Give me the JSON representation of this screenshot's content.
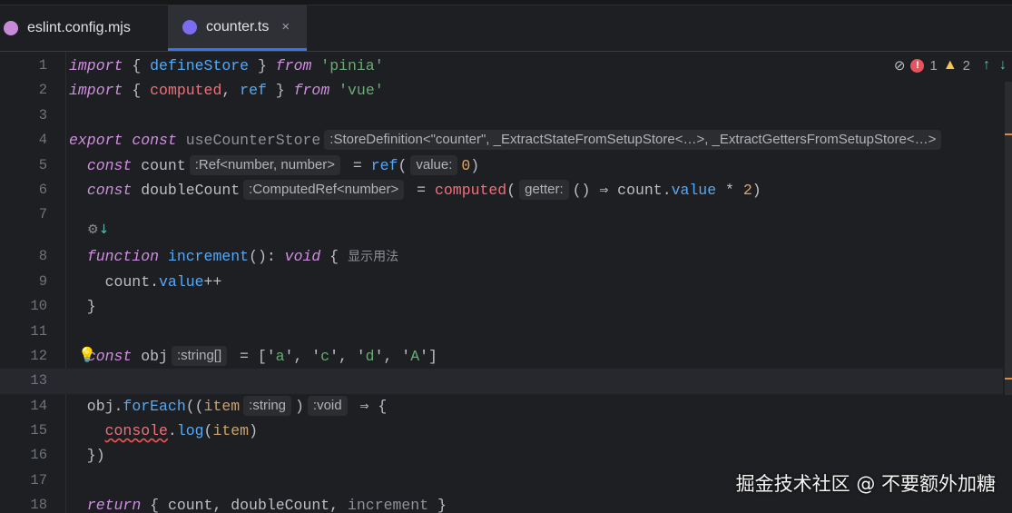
{
  "tabs": [
    {
      "label": "eslint.config.mjs",
      "icon": "eslint-icon",
      "active": false
    },
    {
      "label": "counter.ts",
      "icon": "typescript-file-icon",
      "active": true,
      "close": "×"
    }
  ],
  "inspections": {
    "errors": "1",
    "warnings": "2"
  },
  "code_vision": {
    "line": 8,
    "label": "显示用法"
  },
  "lines": [
    {
      "n": "1",
      "tokens": [
        [
          "k",
          "import"
        ],
        [
          "d",
          " { "
        ],
        [
          "f",
          "defineStore"
        ],
        [
          "d",
          " } "
        ],
        [
          "k",
          "from"
        ],
        [
          "d",
          " "
        ],
        [
          "s",
          "'pinia'"
        ]
      ]
    },
    {
      "n": "2",
      "tokens": [
        [
          "k",
          "import"
        ],
        [
          "d",
          " { "
        ],
        [
          "r",
          "computed"
        ],
        [
          "d",
          ", "
        ],
        [
          "f",
          "ref"
        ],
        [
          "d",
          " } "
        ],
        [
          "k",
          "from"
        ],
        [
          "d",
          " "
        ],
        [
          "s",
          "'vue'"
        ]
      ]
    },
    {
      "n": "3",
      "tokens": []
    },
    {
      "n": "4",
      "tokens": [
        [
          "k",
          "export"
        ],
        [
          "d",
          " "
        ],
        [
          "k",
          "const"
        ],
        [
          "d",
          " "
        ],
        [
          "g",
          "useCounterStore"
        ],
        [
          "h",
          ":StoreDefinition<\"counter\", _ExtractStateFromSetupStore<…>, _ExtractGettersFromSetupStore<…>"
        ]
      ]
    },
    {
      "n": "5",
      "tokens": [
        [
          "d",
          "  "
        ],
        [
          "k",
          "const"
        ],
        [
          "d",
          " count"
        ],
        [
          "h",
          ":Ref<number, number>"
        ],
        [
          "d",
          " = "
        ],
        [
          "f",
          "ref"
        ],
        [
          "d",
          "("
        ],
        [
          "h",
          "value:"
        ],
        [
          "n",
          "0"
        ],
        [
          "d",
          ")"
        ]
      ]
    },
    {
      "n": "6",
      "tokens": [
        [
          "d",
          "  "
        ],
        [
          "k",
          "const"
        ],
        [
          "d",
          " doubleCount"
        ],
        [
          "h",
          ":ComputedRef<number>"
        ],
        [
          "d",
          " = "
        ],
        [
          "r",
          "computed"
        ],
        [
          "d",
          "("
        ],
        [
          "h",
          "getter:"
        ],
        [
          "d",
          "() ⇒ count."
        ],
        [
          "f",
          "value"
        ],
        [
          "d",
          " * "
        ],
        [
          "n",
          "2"
        ],
        [
          "d",
          ")"
        ]
      ]
    },
    {
      "n": "7",
      "tokens": []
    },
    {
      "n": "8",
      "tokens": [
        [
          "d",
          "  "
        ],
        [
          "k",
          "function"
        ],
        [
          "d",
          " "
        ],
        [
          "f",
          "increment"
        ],
        [
          "d",
          "(): "
        ],
        [
          "k",
          "void"
        ],
        [
          "d",
          " {"
        ],
        [
          "u",
          "显示用法"
        ]
      ]
    },
    {
      "n": "9",
      "tokens": [
        [
          "d",
          "    count."
        ],
        [
          "f",
          "value"
        ],
        [
          "d",
          "++"
        ]
      ]
    },
    {
      "n": "10",
      "tokens": [
        [
          "d",
          "  }"
        ]
      ]
    },
    {
      "n": "11",
      "tokens": []
    },
    {
      "n": "12",
      "tokens": [
        [
          "d",
          "  "
        ],
        [
          "k",
          "const"
        ],
        [
          "d",
          " obj"
        ],
        [
          "h",
          ":string[]"
        ],
        [
          "d",
          " = ['"
        ],
        [
          "s",
          "a"
        ],
        [
          "d",
          "', '"
        ],
        [
          "s",
          "c"
        ],
        [
          "d",
          "', '"
        ],
        [
          "s",
          "d"
        ],
        [
          "d",
          "', '"
        ],
        [
          "s",
          "A"
        ],
        [
          "d",
          "']"
        ]
      ]
    },
    {
      "n": "13",
      "tokens": [],
      "current": true
    },
    {
      "n": "14",
      "tokens": [
        [
          "d",
          "  obj."
        ],
        [
          "f",
          "forEach"
        ],
        [
          "d",
          "(("
        ],
        [
          "p",
          "item"
        ],
        [
          "h",
          ":string"
        ],
        [
          "d",
          ")"
        ],
        [
          "h",
          ":void"
        ],
        [
          "d",
          " ⇒ {"
        ]
      ]
    },
    {
      "n": "15",
      "tokens": [
        [
          "d",
          "    "
        ],
        [
          "e",
          "console"
        ],
        [
          "d",
          "."
        ],
        [
          "f",
          "log"
        ],
        [
          "d",
          "("
        ],
        [
          "p",
          "item"
        ],
        [
          "d",
          ")"
        ]
      ]
    },
    {
      "n": "16",
      "tokens": [
        [
          "d",
          "  })"
        ]
      ]
    },
    {
      "n": "17",
      "tokens": []
    },
    {
      "n": "18",
      "tokens": [
        [
          "d",
          "  "
        ],
        [
          "k",
          "return"
        ],
        [
          "d",
          " { count, doubleCount, "
        ],
        [
          "g",
          "increment"
        ],
        [
          "d",
          " }"
        ]
      ]
    }
  ],
  "watermark": "掘金技术社区 @ 不要额外加糖"
}
